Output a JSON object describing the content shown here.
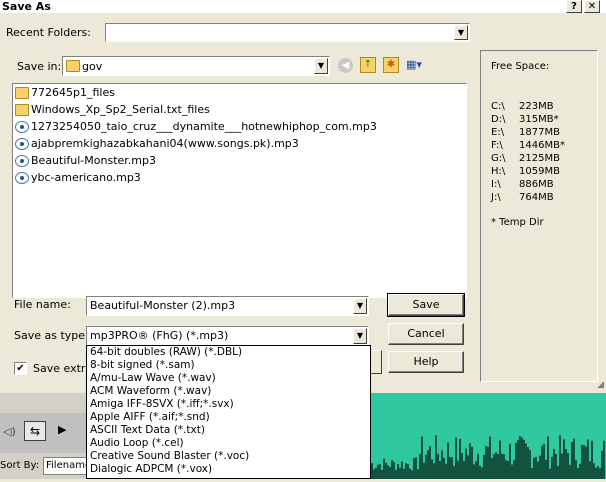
{
  "window": {
    "title": "Save As",
    "help_btn": "?",
    "close_btn": "✕"
  },
  "recent_folders": {
    "label": "Recent Folders:",
    "value": ""
  },
  "save_in": {
    "label": "Save in:",
    "value": "gov"
  },
  "files": [
    {
      "name": "772645p1_files",
      "kind": "folder"
    },
    {
      "name": "Windows_Xp_Sp2_Serial.txt_files",
      "kind": "folder"
    },
    {
      "name": "1273254050_taio_cruz___dynamite___hotnewhiphop_com.mp3",
      "kind": "mp3"
    },
    {
      "name": "ajabpremkighazabkahani04(www.songs.pk).mp3",
      "kind": "mp3"
    },
    {
      "name": "Beautiful-Monster.mp3",
      "kind": "mp3"
    },
    {
      "name": "ybc-americano.mp3",
      "kind": "mp3"
    }
  ],
  "file_name": {
    "label": "File name:",
    "value": "Beautiful-Monster (2).mp3"
  },
  "save_as_type": {
    "label": "Save as type:",
    "value": "mp3PRO® (FhG) (*.mp3)"
  },
  "buttons": {
    "save": "Save",
    "cancel": "Cancel",
    "help": "Help"
  },
  "save_extra": {
    "label": "Save extra",
    "checked": true
  },
  "free_space": {
    "title": "Free Space:",
    "drives": [
      {
        "drive": "C:\\",
        "size": "223MB"
      },
      {
        "drive": "D:\\",
        "size": "315MB*"
      },
      {
        "drive": "E:\\",
        "size": "1877MB"
      },
      {
        "drive": "F:\\",
        "size": "1446MB*"
      },
      {
        "drive": "G:\\",
        "size": "2125MB"
      },
      {
        "drive": "H:\\",
        "size": "1059MB"
      },
      {
        "drive": "I:\\",
        "size": "886MB"
      },
      {
        "drive": "J:\\",
        "size": "764MB"
      }
    ],
    "note": "* Temp Dir"
  },
  "type_options": [
    "64-bit doubles (RAW) (*.DBL)",
    "8-bit signed (*.sam)",
    "A/mu-Law Wave (*.wav)",
    "ACM Waveform (*.wav)",
    "Amiga IFF-8SVX (*.iff;*.svx)",
    "Apple AIFF (*.aif;*.snd)",
    "ASCII Text Data (*.txt)",
    "Audio Loop (*.cel)",
    "Creative Sound Blaster (*.voc)",
    "Dialogic ADPCM (*.vox)"
  ],
  "background": {
    "sort_label": "Sort By:",
    "sort_value": "Filename"
  },
  "colors": {
    "wave_bg": "#30c8a0",
    "wave_fg": "#0a2a20"
  }
}
